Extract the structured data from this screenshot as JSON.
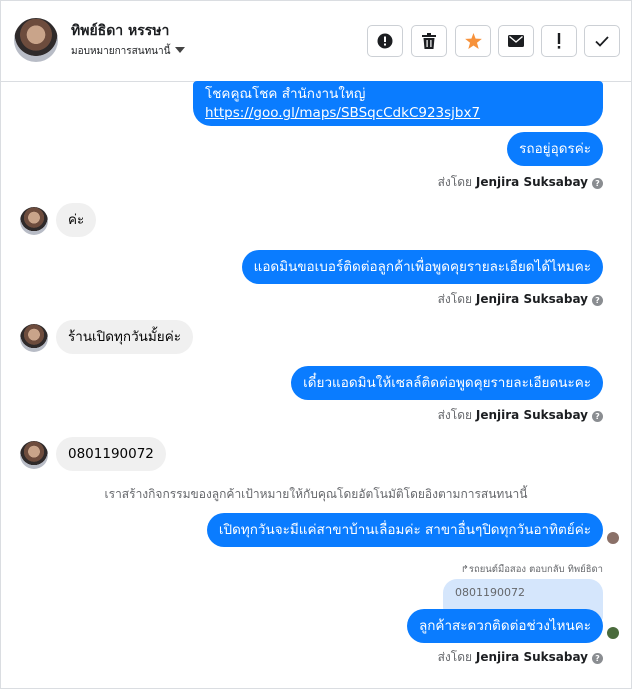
{
  "header": {
    "contact_name": "ทิพย์ธิดา หรรษา",
    "assign_label": "มอบหมายการสนทนานี้",
    "toolbar": [
      {
        "name": "report-spam-button",
        "icon": "exclamation-circle-icon"
      },
      {
        "name": "delete-button",
        "icon": "trash-icon"
      },
      {
        "name": "star-button",
        "icon": "star-icon",
        "color": "#f7923b"
      },
      {
        "name": "mark-unread-button",
        "icon": "envelope-icon"
      },
      {
        "name": "follow-up-button",
        "icon": "exclamation-icon"
      },
      {
        "name": "mark-done-button",
        "icon": "checkmark-icon"
      }
    ]
  },
  "thread": {
    "msg1_line1": "โชคคูณโชค สำนักงานใหญ่",
    "msg1_link": "https://goo.gl/maps/SBSqcCdkC923sjbx7",
    "msg2": "รถอยู่อุดรค่ะ",
    "sent_by_prefix": "ส่งโดย",
    "sent_by_name": "Jenjira Suksabay",
    "in1": "ค่ะ",
    "msg3": "แอดมินขอเบอร์ติดต่อลูกค้าเพื่อพูดคุยรายละเอียดได้ไหมคะ",
    "in2": "ร้านเปิดทุกวันมั้ยค่ะ",
    "msg4": "เดี๋ยวแอดมินให้เซลล์ติดต่อพูดคุยรายละเอียดนะคะ",
    "in3": "0801190072",
    "system_note": "เราสร้างกิจกรรมของลูกค้าเป้าหมายให้กับคุณโดยอัตโนมัติโดยอิงตามการสนทนานี้",
    "msg5": "เปิดทุกวันจะมีแค่สาขาบ้านเลื่อมค่ะ สาขาอื่นๆปิดทุกวันอาทิตย์ค่ะ",
    "reply_label": "รถยนต์มือสอง ตอบกลับ ทิพย์ธิดา",
    "quoted_text": "0801190072",
    "msg6": "ลูกค้าสะดวกติดต่อช่วงไหนคะ"
  },
  "colors": {
    "accent": "#0a7cff",
    "incoming_bg": "#f0f0f0",
    "quote_bg": "#d5e6fc",
    "star": "#f7923b"
  }
}
